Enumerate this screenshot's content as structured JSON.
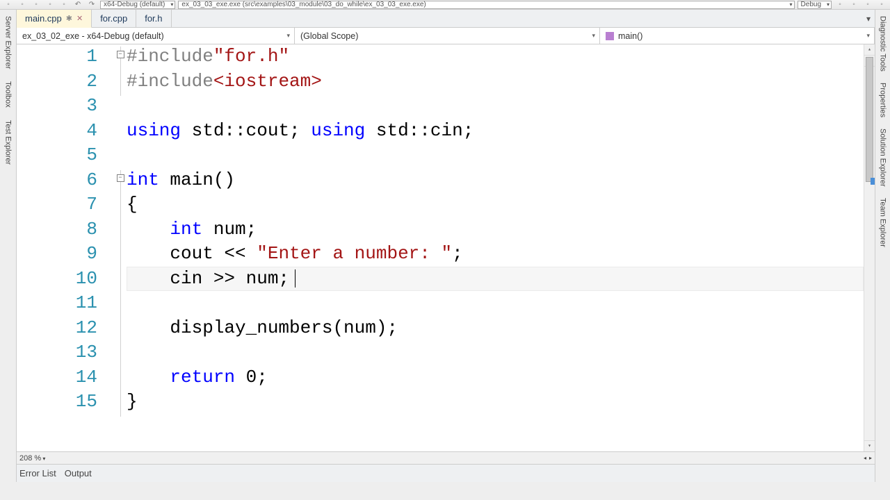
{
  "toolbar": {
    "config_combo": "x64-Debug (default)",
    "target_combo": "ex_03_03_exe.exe (src\\examples\\03_module\\03_do_while\\ex_03_03_exe.exe)",
    "debug_combo": "Debug"
  },
  "doc_tabs": [
    {
      "label": "main.cpp",
      "active": true,
      "modified": true
    },
    {
      "label": "for.cpp",
      "active": false,
      "modified": false
    },
    {
      "label": "for.h",
      "active": false,
      "modified": false
    }
  ],
  "nav": {
    "project": "ex_03_02_exe - x64-Debug (default)",
    "scope": "(Global Scope)",
    "member": "main()"
  },
  "code": {
    "lines": [
      {
        "n": 1,
        "fold": "box",
        "tokens": [
          [
            "pp",
            "#include"
          ],
          [
            "str",
            "\"for.h\""
          ]
        ]
      },
      {
        "n": 2,
        "fold": "line",
        "tokens": [
          [
            "pp",
            "#include"
          ],
          [
            "angle",
            "<iostream>"
          ]
        ]
      },
      {
        "n": 3,
        "fold": "",
        "tokens": []
      },
      {
        "n": 4,
        "fold": "",
        "tokens": [
          [
            "kw",
            "using"
          ],
          [
            "txt",
            " std::cout; "
          ],
          [
            "kw",
            "using"
          ],
          [
            "txt",
            " std::cin;"
          ]
        ]
      },
      {
        "n": 5,
        "fold": "",
        "tokens": []
      },
      {
        "n": 6,
        "fold": "box",
        "tokens": [
          [
            "kw",
            "int"
          ],
          [
            "txt",
            " main()"
          ]
        ]
      },
      {
        "n": 7,
        "fold": "line",
        "tokens": [
          [
            "txt",
            "{"
          ]
        ]
      },
      {
        "n": 8,
        "fold": "line",
        "tokens": [
          [
            "txt",
            "    "
          ],
          [
            "kw",
            "int"
          ],
          [
            "txt",
            " num;"
          ]
        ]
      },
      {
        "n": 9,
        "fold": "line",
        "tokens": [
          [
            "txt",
            "    cout << "
          ],
          [
            "str",
            "\"Enter a number: \""
          ],
          [
            "txt",
            ";"
          ]
        ]
      },
      {
        "n": 10,
        "fold": "line",
        "hl": true,
        "cursor": true,
        "tokens": [
          [
            "txt",
            "    cin >> num;"
          ]
        ]
      },
      {
        "n": 11,
        "fold": "line",
        "tokens": []
      },
      {
        "n": 12,
        "fold": "line",
        "tokens": [
          [
            "txt",
            "    display_numbers(num);"
          ]
        ]
      },
      {
        "n": 13,
        "fold": "line",
        "tokens": []
      },
      {
        "n": 14,
        "fold": "line",
        "tokens": [
          [
            "txt",
            "    "
          ],
          [
            "kw",
            "return"
          ],
          [
            "txt",
            " 0;"
          ]
        ]
      },
      {
        "n": 15,
        "fold": "line",
        "tokens": [
          [
            "txt",
            "}"
          ]
        ]
      }
    ]
  },
  "zoom": "208 %",
  "bottom_tabs": [
    "Error List",
    "Output"
  ],
  "left_tabs": [
    "Server Explorer",
    "Toolbox",
    "Test Explorer"
  ],
  "right_tabs": [
    "Diagnostic Tools",
    "Properties",
    "Solution Explorer",
    "Team Explorer"
  ]
}
